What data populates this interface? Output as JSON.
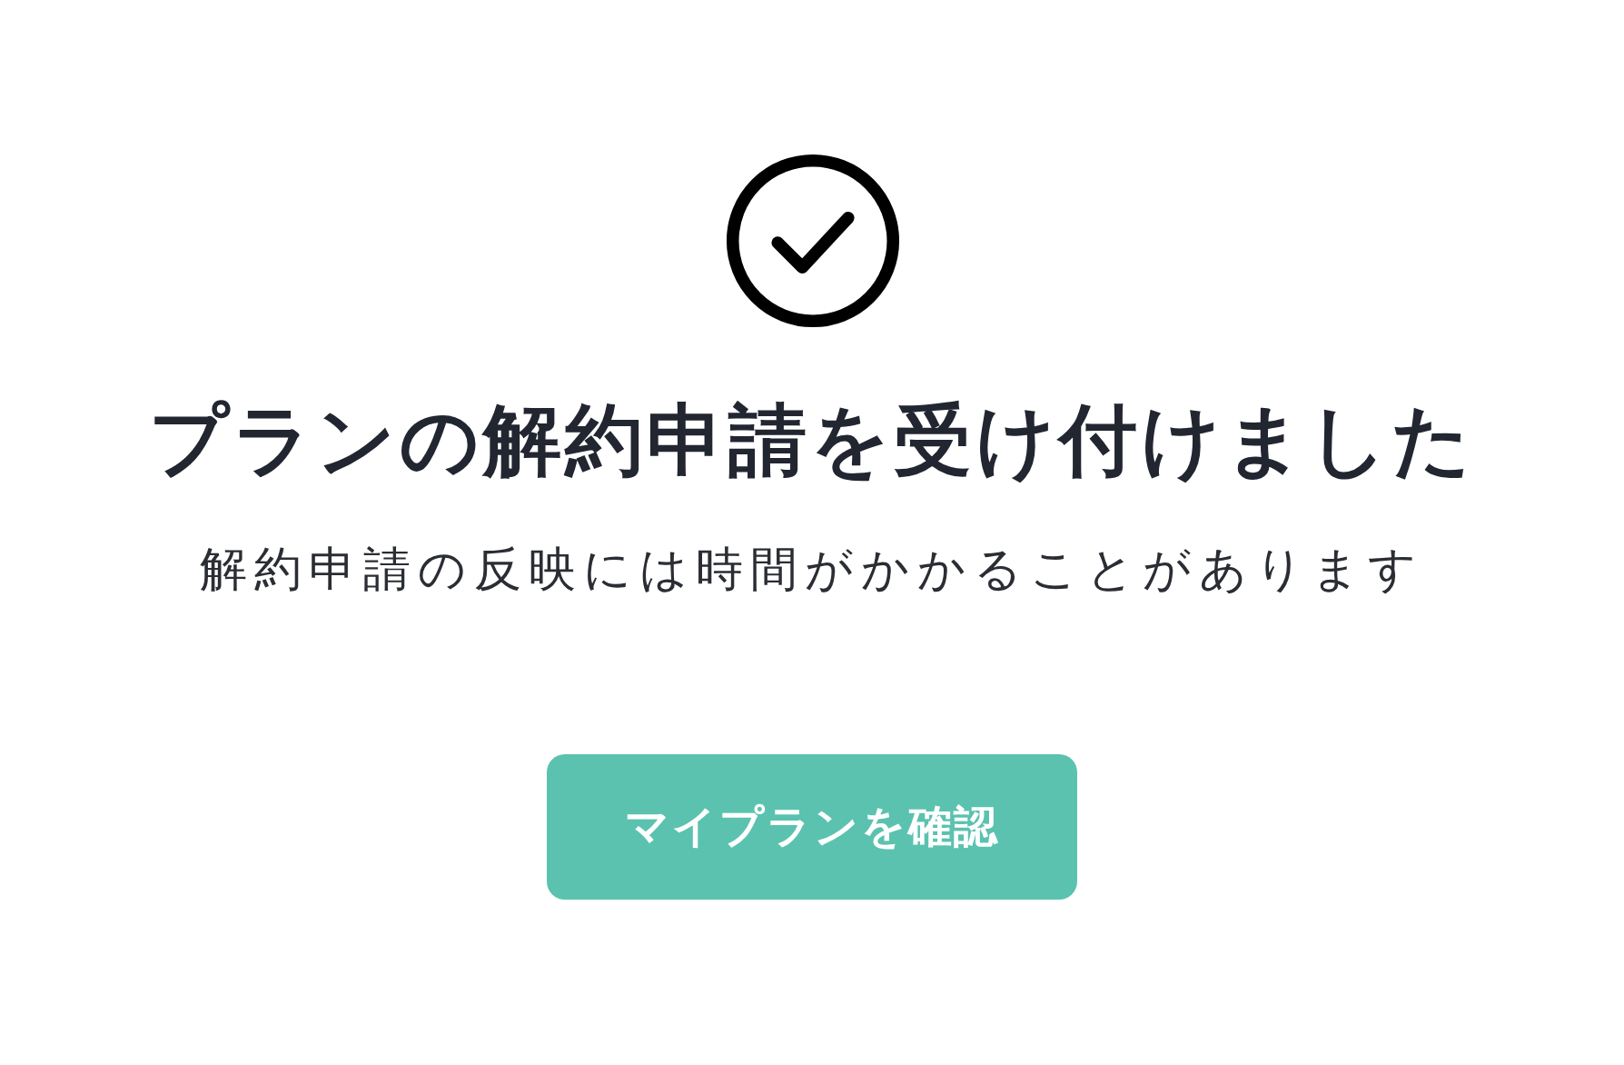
{
  "title": "プランの解約申請を受け付けました",
  "message": "解約申請の反映には時間がかかることがあります",
  "button": {
    "label": "マイプランを確認"
  }
}
